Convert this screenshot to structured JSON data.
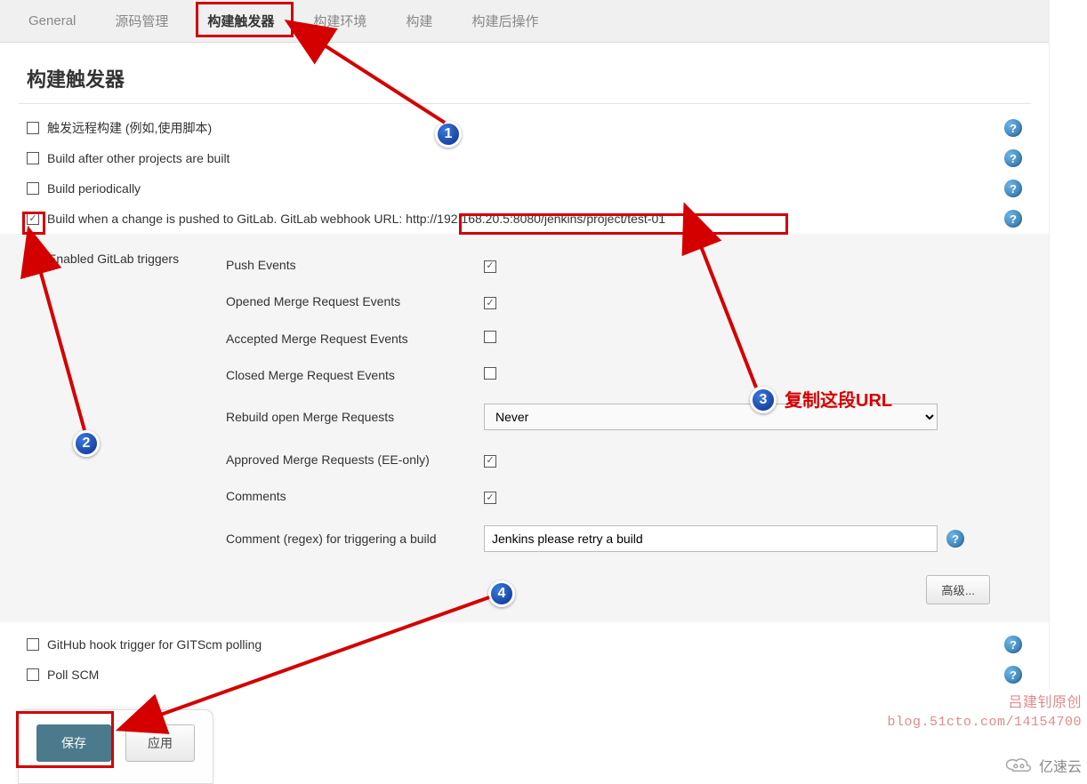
{
  "tabs": {
    "general": "General",
    "scm": "源码管理",
    "triggers": "构建触发器",
    "env": "构建环境",
    "build": "构建",
    "post": "构建后操作"
  },
  "section_title": "构建触发器",
  "opts": {
    "remote": {
      "label": "触发远程构建 (例如,使用脚本)",
      "checked": false
    },
    "after": {
      "label": "Build after other projects are built",
      "checked": false
    },
    "period": {
      "label": "Build periodically",
      "checked": false
    },
    "gitlab": {
      "label_prefix": "Build when a change is pushed to GitLab. GitLab webhook URL:",
      "url": "http://192.168.20.5:8080/jenkins/project/test-01",
      "checked": true
    },
    "github": {
      "label": "GitHub hook trigger for GITScm polling",
      "checked": false
    },
    "pollscm": {
      "label": "Poll SCM",
      "checked": false
    }
  },
  "gitlab_section": {
    "title": "Enabled GitLab triggers",
    "rows": {
      "push": {
        "label": "Push Events",
        "checked": true
      },
      "opened": {
        "label": "Opened Merge Request Events",
        "checked": true
      },
      "accepted": {
        "label": "Accepted Merge Request Events",
        "checked": false
      },
      "closed": {
        "label": "Closed Merge Request Events",
        "checked": false
      },
      "rebuild": {
        "label": "Rebuild open Merge Requests",
        "value": "Never"
      },
      "approved": {
        "label": "Approved Merge Requests (EE-only)",
        "checked": true
      },
      "comments": {
        "label": "Comments",
        "checked": true
      },
      "regex": {
        "label": "Comment (regex) for triggering a build",
        "value": "Jenkins please retry a build"
      }
    },
    "advanced": "高级..."
  },
  "buttons": {
    "save": "保存",
    "apply": "应用"
  },
  "annotations": {
    "b1": "1",
    "b2": "2",
    "b3": "3",
    "b4": "4",
    "copy_url": "复制这段URL"
  },
  "watermark": {
    "line1": "吕建钊原创",
    "line2": "blog.51cto.com/14154700"
  },
  "logo_text": "亿速云"
}
